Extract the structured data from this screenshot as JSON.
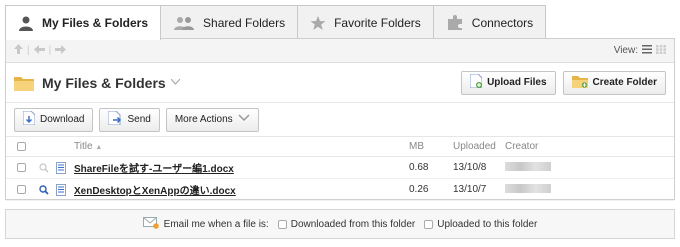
{
  "tabs": [
    {
      "label": "My Files & Folders",
      "icon": "user-icon",
      "active": true
    },
    {
      "label": "Shared Folders",
      "icon": "users-icon",
      "active": false
    },
    {
      "label": "Favorite Folders",
      "icon": "star-icon",
      "active": false
    },
    {
      "label": "Connectors",
      "icon": "puzzle-icon",
      "active": false
    }
  ],
  "nav": {
    "view_label": "View:"
  },
  "folder": {
    "title": "My Files & Folders"
  },
  "buttons": {
    "upload": "Upload Files",
    "create_folder": "Create Folder",
    "download": "Download",
    "send": "Send",
    "more_actions": "More Actions"
  },
  "table": {
    "headers": {
      "title": "Title",
      "mb": "MB",
      "uploaded": "Uploaded",
      "creator": "Creator"
    },
    "rows": [
      {
        "title": "ShareFileを試す-ユーザー編1.docx",
        "mb": "0.68",
        "uploaded": "13/10/8"
      },
      {
        "title": "XenDesktopとXenAppの違い.docx",
        "mb": "0.26",
        "uploaded": "13/10/7"
      }
    ]
  },
  "email": {
    "prompt": "Email me when a file is:",
    "option_downloaded": "Downloaded from this folder",
    "option_uploaded": "Uploaded to this folder"
  },
  "colors": {
    "accent_folder": "#f2c14e",
    "doc_blue": "#3b6fc4",
    "upload_green": "#5aa640"
  }
}
